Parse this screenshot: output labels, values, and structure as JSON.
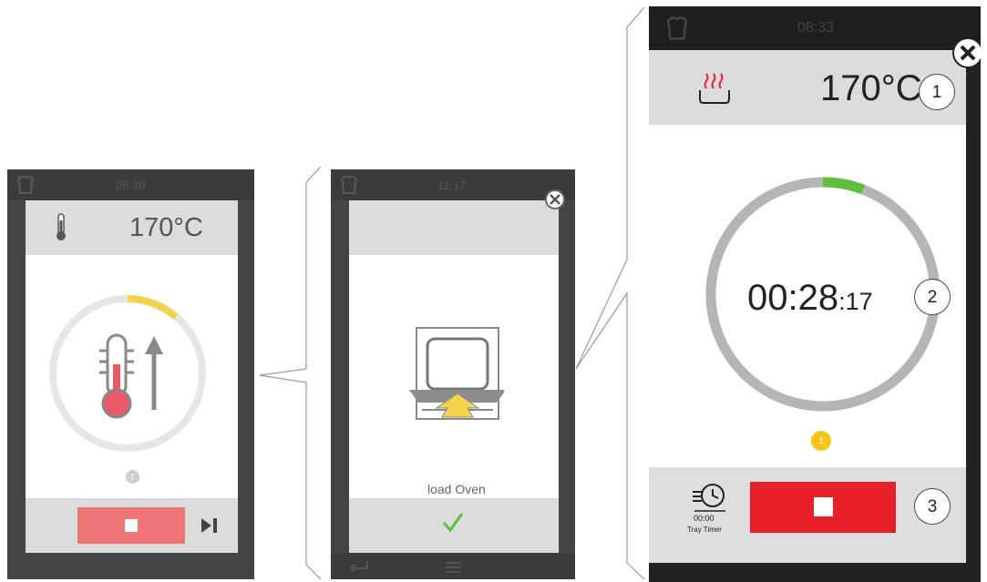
{
  "screen_left": {
    "clock": "08:30",
    "temperature": "170°C",
    "phase_indicator": "1",
    "icons": [
      "chef-hat-icon",
      "thermometer-icon",
      "thermometer-rising-icon",
      "stop-icon",
      "skip-next-icon"
    ],
    "progress_color": "#f2d34f",
    "stop_color": "#ef7478"
  },
  "screen_middle": {
    "clock": "11:17",
    "message": "load Oven",
    "icons": [
      "chef-hat-icon",
      "close-icon",
      "load-oven-icon",
      "checkmark-icon",
      "back-icon",
      "menu-icon"
    ],
    "check_color": "#5cbf3f"
  },
  "screen_right": {
    "clock": "08:33",
    "temperature": "170°C",
    "timer_main": "00:28",
    "timer_seconds": ":17",
    "phase_indicator": "1",
    "tray_timer_value": "00:00",
    "tray_timer_label": "Tray Timer",
    "icons": [
      "chef-hat-icon",
      "close-icon",
      "heat-icon",
      "tray-timer-icon",
      "stop-icon"
    ],
    "progress_color": "#5cbf3f",
    "stop_color": "#e8202a",
    "phase_color": "#f5c518"
  },
  "callouts": [
    "1",
    "2",
    "3"
  ]
}
